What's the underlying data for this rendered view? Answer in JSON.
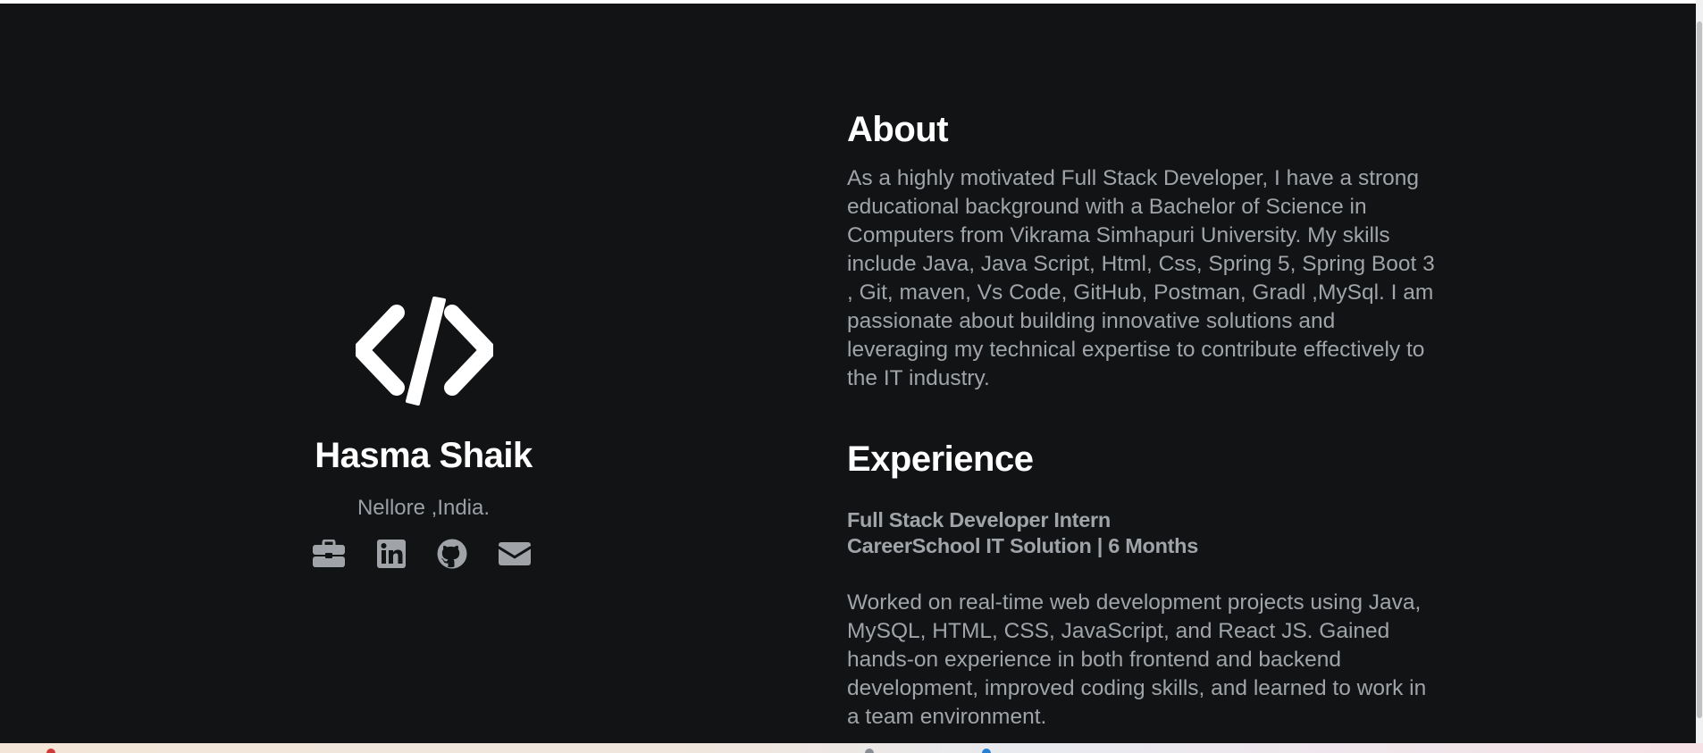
{
  "profile": {
    "logo_icon": "code-slash-icon",
    "name": "Hasma Shaik",
    "location": "Nellore ,India.",
    "socials": [
      {
        "icon": "briefcase-icon"
      },
      {
        "icon": "linkedin-icon"
      },
      {
        "icon": "github-icon"
      },
      {
        "icon": "envelope-icon"
      }
    ]
  },
  "about": {
    "title": "About",
    "text": "As a highly motivated Full Stack Developer, I have a strong educational background with a Bachelor of Science in Computers from Vikrama Simhapuri University. My skills include Java, Java Script, Html, Css, Spring 5, Spring Boot 3 , Git, maven, Vs Code, GitHub, Postman, Gradl ,MySql. I am passionate about building innovative solutions and leveraging my technical expertise to contribute effectively to the IT industry."
  },
  "experience": {
    "title": "Experience",
    "jobs": [
      {
        "role": "Full Stack Developer Intern",
        "company": "CareerSchool IT Solution | 6 Months",
        "description": "Worked on real-time web development projects using Java, MySQL, HTML, CSS, JavaScript, and React JS. Gained hands-on experience in both frontend and backend development, improved coding skills, and learned to work in a team environment."
      }
    ]
  },
  "colors": {
    "background": "#111315",
    "heading": "#ffffff",
    "body_text": "#a0a4a8",
    "icon": "#a0a4a8"
  }
}
